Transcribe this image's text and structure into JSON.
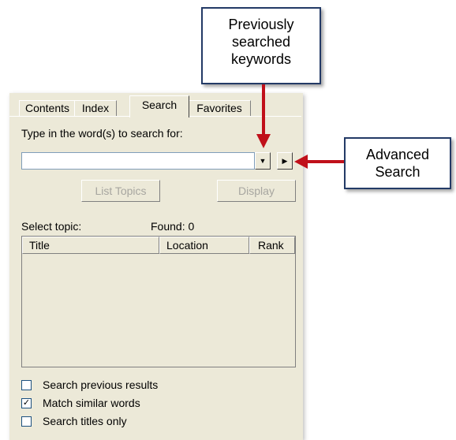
{
  "tabs": {
    "contents": "Contents",
    "index": "Index",
    "search": "Search",
    "favorites": "Favorites"
  },
  "search": {
    "prompt": "Type in the word(s) to search for:",
    "value": "",
    "placeholder": ""
  },
  "buttons": {
    "list_topics": "List Topics",
    "display": "Display"
  },
  "results": {
    "select_label": "Select topic:",
    "found_label": "Found: 0",
    "columns": [
      "Title",
      "Location",
      "Rank"
    ]
  },
  "options": [
    {
      "label": "Search previous results",
      "checked": false
    },
    {
      "label": "Match similar words",
      "checked": true
    },
    {
      "label": "Search titles only",
      "checked": false
    }
  ],
  "callouts": {
    "previous_keywords": [
      "Previously",
      "searched",
      "keywords"
    ],
    "advanced_search": [
      "Advanced",
      "Search"
    ]
  },
  "colors": {
    "arrow": "#c0101a",
    "callout_border": "#233a66",
    "panel": "#ece9d8"
  },
  "icons": {
    "dropdown": "▼",
    "advanced": "▶",
    "check": "✓"
  }
}
